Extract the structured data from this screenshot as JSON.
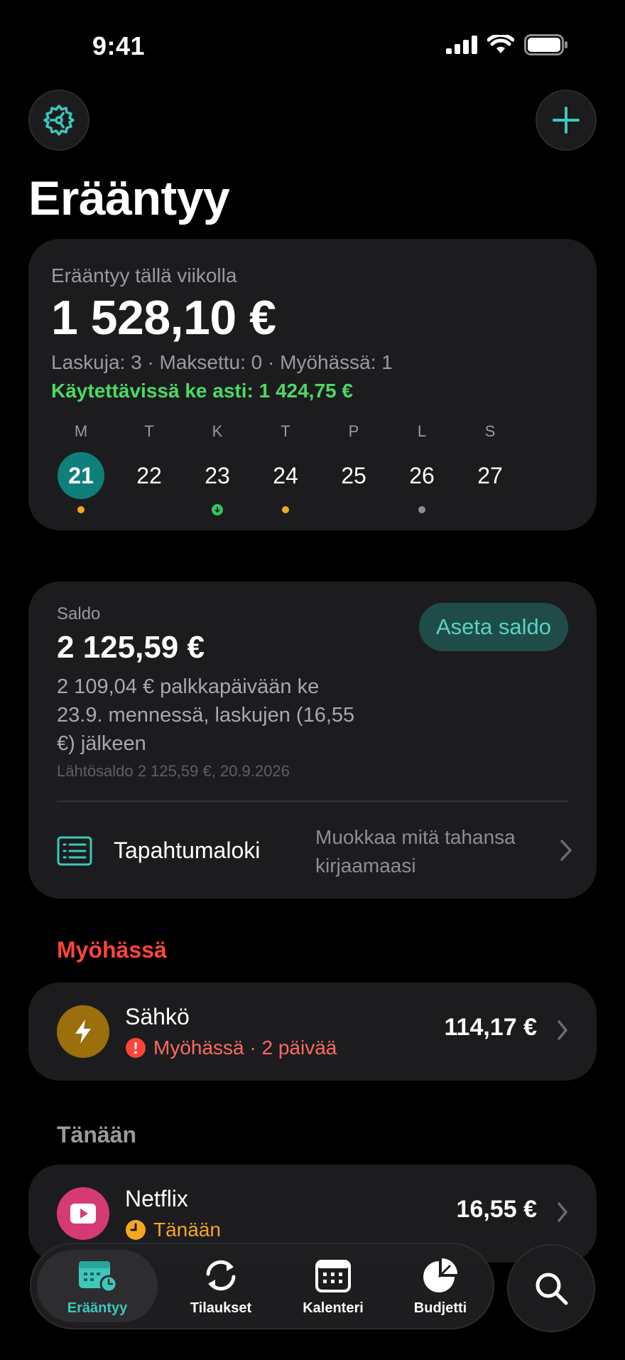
{
  "status_bar": {
    "time": "9:41"
  },
  "header": {
    "title": "Erääntyy"
  },
  "week": {
    "label": "Erääntyy tällä viikolla",
    "total": "1 528,10 €",
    "meta": "Laskuja: 3 · Maksettu: 0 · Myöhässä: 1",
    "available": "Käytettävissä ke asti: 1 424,75 €",
    "days": [
      {
        "letter": "M",
        "num": "21",
        "selected": true,
        "dot": "orange"
      },
      {
        "letter": "T",
        "num": "22",
        "selected": false,
        "dot": ""
      },
      {
        "letter": "K",
        "num": "23",
        "selected": false,
        "dot": "green"
      },
      {
        "letter": "T",
        "num": "24",
        "selected": false,
        "dot": "orange"
      },
      {
        "letter": "P",
        "num": "25",
        "selected": false,
        "dot": ""
      },
      {
        "letter": "L",
        "num": "26",
        "selected": false,
        "dot": "gray"
      },
      {
        "letter": "S",
        "num": "27",
        "selected": false,
        "dot": ""
      }
    ]
  },
  "saldo": {
    "label": "Saldo",
    "value": "2 125,59 €",
    "description": "2 109,04 € palkkapäivään ke 23.9. mennessä, laskujen (16,55 €) jälkeen",
    "start": "Lähtösaldo 2 125,59 €, 20.9.2026",
    "set_button": "Aseta saldo",
    "log_title": "Tapahtumaloki",
    "log_hint": "Muokkaa mitä tahansa kirjaamaasi"
  },
  "sections": {
    "late": {
      "title": "Myöhässä",
      "item": {
        "name": "Sähkö",
        "status": "Myöhässä · 2 päivää",
        "amount": "114,17 €"
      }
    },
    "today": {
      "title": "Tänään",
      "item": {
        "name": "Netflix",
        "status": "Tänään",
        "amount": "16,55 €"
      }
    }
  },
  "tabs": [
    {
      "label": "Erääntyy"
    },
    {
      "label": "Tilaukset"
    },
    {
      "label": "Kalenteri"
    },
    {
      "label": "Budjetti"
    }
  ],
  "colors": {
    "accent": "#3dc8bb",
    "late": "#ff453a",
    "today": "#f5a623",
    "available": "#4cd964",
    "electricity_icon_bg": "#9a6f0c",
    "netflix_icon_bg": "#d63a74"
  }
}
